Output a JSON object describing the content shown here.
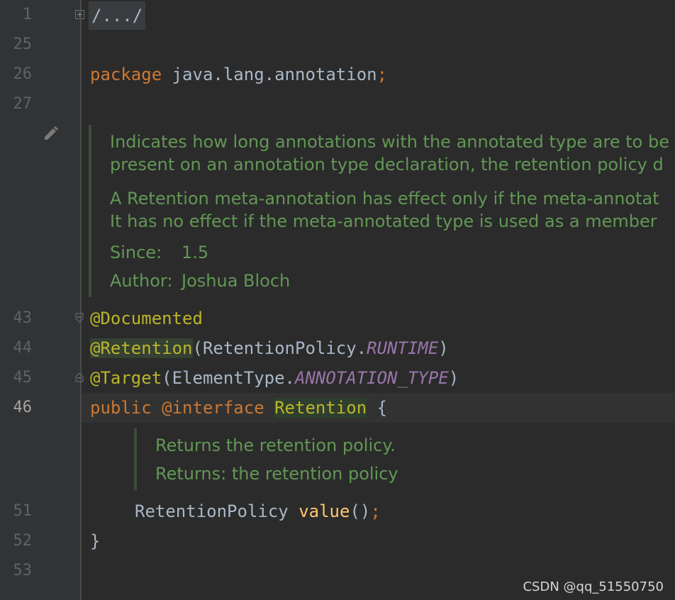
{
  "line_numbers": [
    "1",
    "25",
    "26",
    "27",
    "43",
    "44",
    "45",
    "46",
    "51",
    "52",
    "53"
  ],
  "folded_text": "/.../",
  "package_line": {
    "keyword": "package",
    "name": " java.lang.annotation",
    "semi": ";"
  },
  "class_doc": {
    "line1": "Indicates how long annotations with the annotated type are to be",
    "line2": "present on an annotation type declaration, the retention policy d",
    "line3": "A Retention meta-annotation has effect only if the meta-annotat",
    "line4": "It has no effect if the meta-annotated type is used as a member",
    "since_label": "Since:",
    "since_value": "1.5",
    "author_label": "Author:",
    "author_value": "Joshua Bloch"
  },
  "annotations": {
    "documented": "@Documented",
    "retention": "@Retention",
    "retention_args_open": "(RetentionPolicy.",
    "retention_const": "RUNTIME",
    "retention_close": ")",
    "target": "@Target",
    "target_args_open": "(ElementType.",
    "target_const": "ANNOTATION_TYPE",
    "target_close": ")"
  },
  "declaration": {
    "public": "public",
    "interface": "@interface",
    "name": "Retention",
    "brace": " {"
  },
  "method_doc": {
    "line1": "Returns the retention policy.",
    "line2": "Returns: the retention policy"
  },
  "method": {
    "type": "RetentionPolicy",
    "name": "value",
    "parens": "()",
    "semi": ";"
  },
  "closing_brace": "}",
  "watermark": "CSDN @qq_51550750",
  "colors": {
    "background": "#2b2b2b",
    "keyword": "#cc7832",
    "annotation": "#bbb529",
    "constant": "#9876aa",
    "method": "#ffc66d",
    "doc": "#629755"
  }
}
